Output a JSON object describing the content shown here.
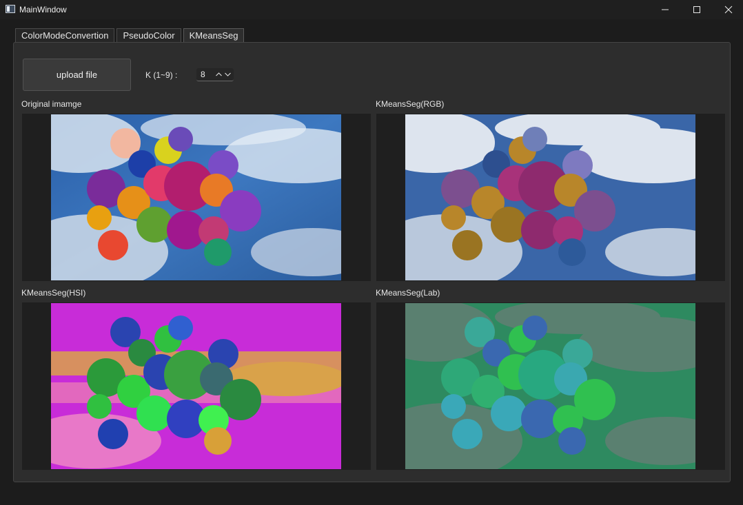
{
  "window": {
    "title": "MainWindow",
    "icon": "app-window-icon",
    "controls": {
      "minimize": "minimize-icon",
      "maximize": "maximize-icon",
      "close": "close-icon"
    }
  },
  "tabs": [
    {
      "label": "ColorModeConvertion",
      "active": false
    },
    {
      "label": "PseudoColor",
      "active": false
    },
    {
      "label": "KMeansSeg",
      "active": true
    }
  ],
  "controls": {
    "upload_label": "upload file",
    "k_label": "K (1~9) :",
    "k_value": "8"
  },
  "panels": {
    "original": {
      "label": "Original imamge"
    },
    "rgb": {
      "label": "KMeansSeg(RGB)"
    },
    "hsi": {
      "label": "KMeansSeg(HSI)"
    },
    "lab": {
      "label": "KMeansSeg(Lab)"
    }
  },
  "colors": {
    "window_bg": "#1c1c1c",
    "panel_bg": "#2d2d2d",
    "image_frame_bg": "#1f1f1f",
    "text": "#e6e6e6"
  }
}
